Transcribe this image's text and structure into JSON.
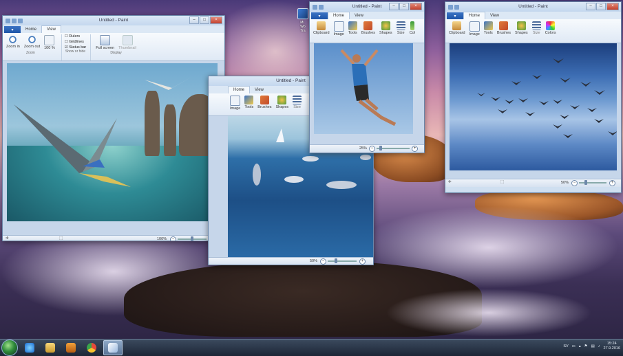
{
  "desktop": {
    "icon_label": "Mi\nWo\nTra"
  },
  "windows": [
    {
      "title": "Untitled - Paint",
      "file_tab": "▾",
      "tabs": [
        "Home",
        "View"
      ],
      "active_tab": "View",
      "ribbon": {
        "zoom_group": [
          "Zoom in",
          "Zoom out",
          "100 %"
        ],
        "zoom_group_label": "Zoom",
        "checks": [
          "Rulers",
          "Gridlines",
          "Status bar"
        ],
        "checks_label": "Show or hide",
        "display": [
          "Full screen",
          "Thumbnail"
        ],
        "display_label": "Display"
      },
      "zoom": "100%"
    },
    {
      "title": "Untitled - Paint",
      "tabs": [
        "Home",
        "View"
      ],
      "active_tab": "Home",
      "ribbon": [
        "Image",
        "Tools",
        "Brushes",
        "Shapes",
        "Size"
      ],
      "zoom": "50%"
    },
    {
      "title": "Untitled - Paint",
      "tabs": [
        "Home",
        "View"
      ],
      "active_tab": "Home",
      "ribbon": [
        "Clipboard",
        "Image",
        "Tools",
        "Brushes",
        "Shapes",
        "Size",
        "Col"
      ],
      "zoom": "25%"
    },
    {
      "title": "Untitled - Paint",
      "tabs": [
        "Home",
        "View"
      ],
      "active_tab": "Home",
      "ribbon": [
        "Clipboard",
        "Image",
        "Tools",
        "Brushes",
        "Shapes",
        "Size",
        "Colors"
      ],
      "zoom": "50%"
    }
  ],
  "taskbar": {
    "lang": "SV",
    "time": "15:24",
    "date": "27.9.2016",
    "icons": [
      "ie-icon",
      "explorer-icon",
      "media-player-icon",
      "chrome-icon",
      "paint-icon"
    ]
  },
  "colors": {
    "taskbar": "#1d2636",
    "paint_title": "#c4d7ee",
    "file_tab": "#1e55a8"
  }
}
